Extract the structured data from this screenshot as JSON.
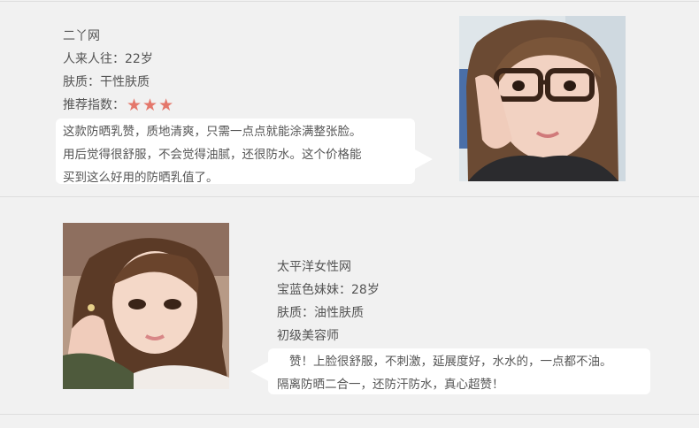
{
  "reviews": [
    {
      "source": "二丫网",
      "name_age": "人来人往：22岁",
      "skin": "肤质：干性肤质",
      "rating_label": "推荐指数：",
      "rating": 3,
      "star_glyph": "★",
      "comment_lines": [
        "这款防晒乳赞，质地清爽，只需一点点就能涂满整张脸。",
        "用后觉得很舒服，不会觉得油腻，还很防水。这个价格能",
        "买到这么好用的防晒乳值了。"
      ],
      "avatar_icon": "reviewer-photo-glasses-girl"
    },
    {
      "source": "太平洋女性网",
      "name_age": "宝蓝色妹妹：28岁",
      "skin": "肤质：油性肤质",
      "title": "初级美容师",
      "comment_lines": [
        "赞！上脸很舒服，不刺激，延展度好，水水的，一点都不油。",
        "隔离防晒二合一，还防汗防水，真心超赞！"
      ],
      "avatar_icon": "reviewer-photo-longhair-girl"
    }
  ],
  "colors": {
    "background": "#f1f1f1",
    "bubble": "#ffffff",
    "star": "#e4776b",
    "divider": "#dddddd",
    "text": "#555555"
  }
}
